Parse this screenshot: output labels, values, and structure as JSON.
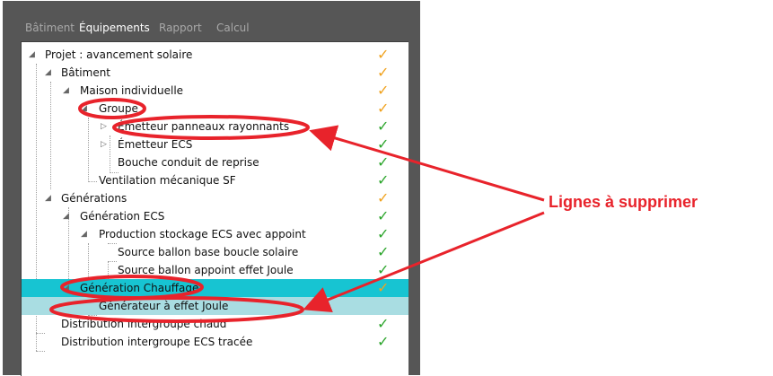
{
  "tabs": [
    {
      "label": "Bâtiment",
      "active": false
    },
    {
      "label": "Équipements",
      "active": true
    },
    {
      "label": "Rapport",
      "active": false
    },
    {
      "label": "Calcul",
      "active": false
    }
  ],
  "colors": {
    "check_orange": "#f0a21e",
    "check_green": "#2ba52b",
    "highlight_cyan": "#17c4d2",
    "highlight_light": "#a9dde2",
    "annotation_red": "#e8232b"
  },
  "tree": [
    {
      "label": "Projet : avancement solaire",
      "level": 0,
      "expander": "open",
      "check": "orange"
    },
    {
      "label": "Bâtiment",
      "level": 1,
      "expander": "open",
      "check": "orange"
    },
    {
      "label": "Maison individuelle",
      "level": 2,
      "expander": "open",
      "check": "orange"
    },
    {
      "label": "Groupe",
      "level": 3,
      "expander": "open",
      "check": "orange"
    },
    {
      "label": "Émetteur panneaux rayonnants",
      "level": 4,
      "expander": "closed",
      "check": "green"
    },
    {
      "label": "Émetteur ECS",
      "level": 4,
      "expander": "closed",
      "check": "green"
    },
    {
      "label": "Bouche conduit de reprise",
      "level": 4,
      "expander": "none",
      "check": "green"
    },
    {
      "label": "Ventilation mécanique SF",
      "level": 3,
      "expander": "none",
      "check": "green"
    },
    {
      "label": "Générations",
      "level": 1,
      "expander": "open",
      "check": "orange"
    },
    {
      "label": "Génération ECS",
      "level": 2,
      "expander": "open",
      "check": "green"
    },
    {
      "label": "Production stockage ECS avec appoint",
      "level": 3,
      "expander": "open",
      "check": "green"
    },
    {
      "label": "Source ballon base boucle solaire",
      "level": 4,
      "expander": "none",
      "check": "green"
    },
    {
      "label": "Source ballon appoint effet Joule",
      "level": 4,
      "expander": "none",
      "check": "green"
    },
    {
      "label": "Génération Chauffage",
      "level": 2,
      "expander": "open",
      "check": "orange",
      "highlight": "cyan"
    },
    {
      "label": "Générateur à effet Joule",
      "level": 3,
      "expander": "none",
      "check": "",
      "highlight": "light"
    },
    {
      "label": "Distribution intergroupe chaud",
      "level": 1,
      "expander": "none",
      "check": "green"
    },
    {
      "label": "Distribution intergroupe ECS tracée",
      "level": 1,
      "expander": "none",
      "check": "green"
    }
  ],
  "annotation": {
    "label": "Lignes à supprimer"
  }
}
